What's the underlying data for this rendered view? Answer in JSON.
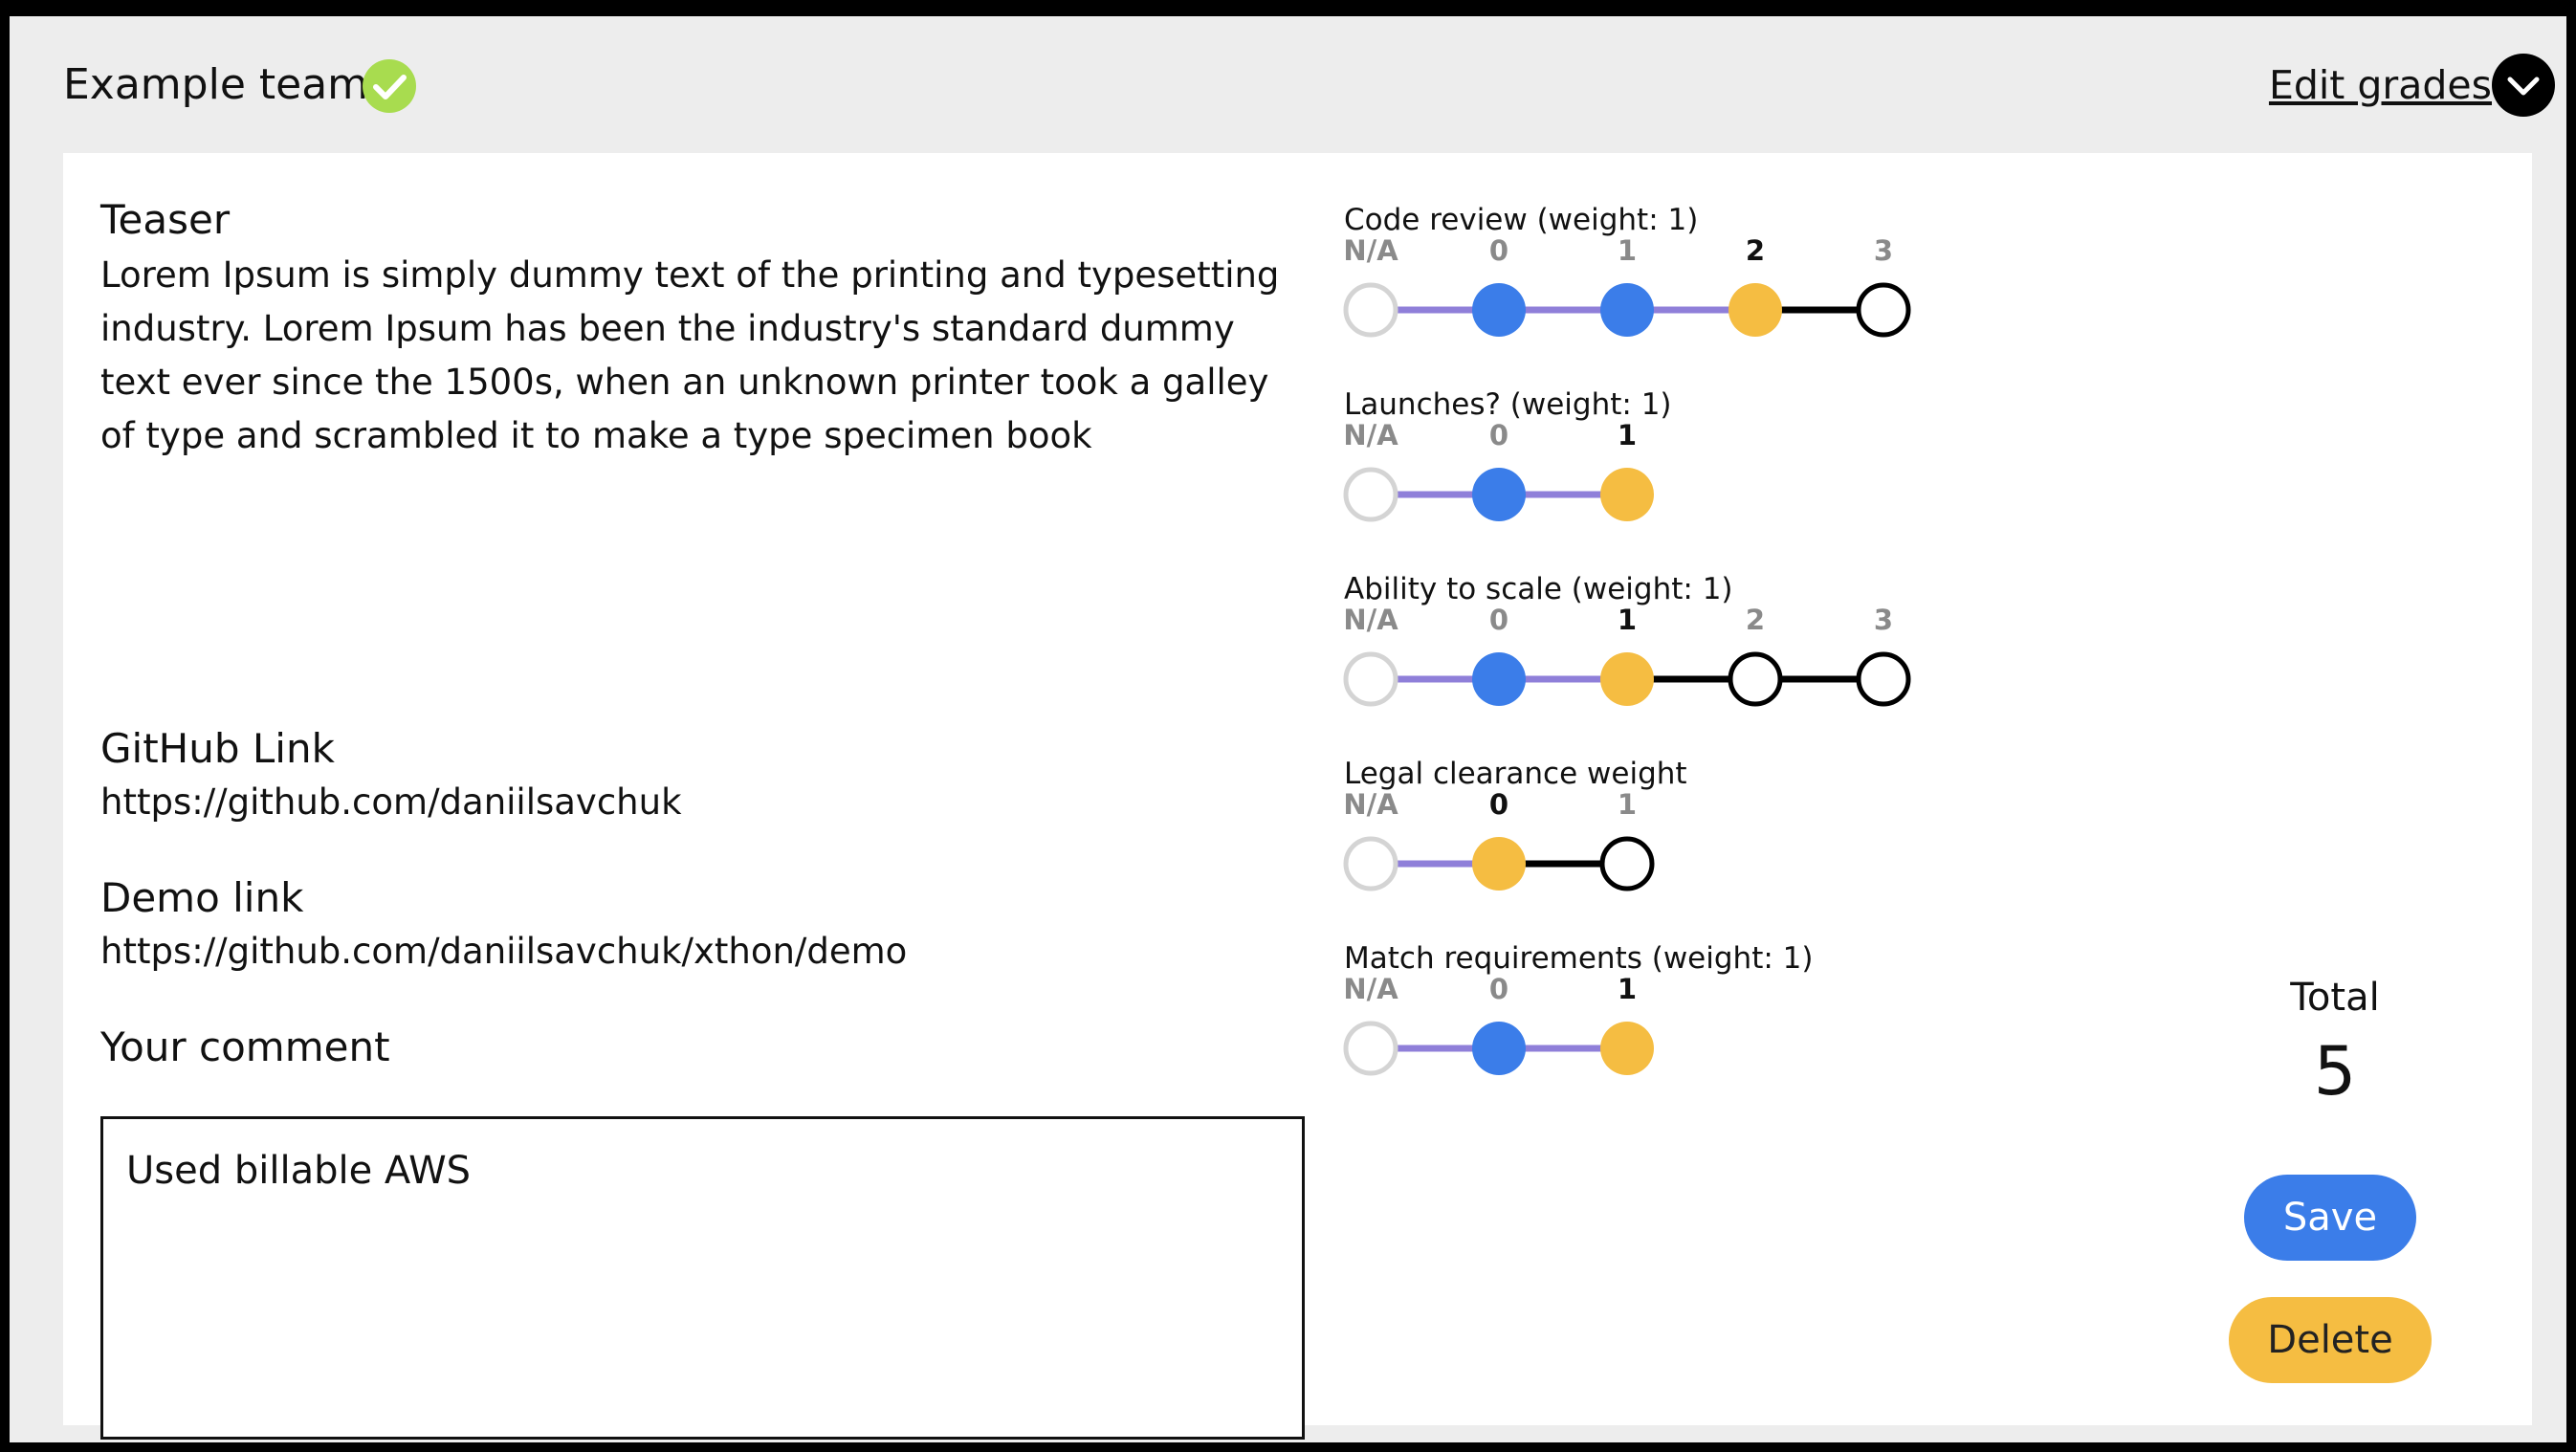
{
  "header": {
    "team_name": "Example team",
    "edit_grades_label": "Edit grades"
  },
  "colors": {
    "accent_blue": "#3b7de9",
    "accent_yellow": "#f5bd42",
    "connector_purple": "#8f7fd9",
    "check_green": "#a8dc4f"
  },
  "icons": {
    "team_status": "check-circle-icon",
    "edit_toggle": "chevron-down-icon"
  },
  "project": {
    "teaser_title": "Teaser",
    "teaser_text": "Lorem Ipsum is simply dummy text of the printing and typesetting industry. Lorem Ipsum has been the industry's standard dummy text ever since the 1500s, when an unknown printer took a galley of type and scrambled it to make a type specimen book",
    "github_title": "GitHub Link",
    "github_url": "https://github.com/daniilsavchuk",
    "demo_title": "Demo link",
    "demo_url": "https://github.com/daniilsavchuk/xthon/demo",
    "comment_title": "Your comment",
    "comment_value": "Used billable AWS"
  },
  "criteria": [
    {
      "title": "Code review (weight: 1)",
      "options": [
        "N/A",
        "0",
        "1",
        "2",
        "3"
      ],
      "selected": "2"
    },
    {
      "title": "Launches? (weight: 1)",
      "options": [
        "N/A",
        "0",
        "1"
      ],
      "selected": "1"
    },
    {
      "title": "Ability to scale (weight: 1)",
      "options": [
        "N/A",
        "0",
        "1",
        "2",
        "3"
      ],
      "selected": "1"
    },
    {
      "title": "Legal clearance weight",
      "options": [
        "N/A",
        "0",
        "1"
      ],
      "selected": "0"
    },
    {
      "title": "Match requirements (weight: 1)",
      "options": [
        "N/A",
        "0",
        "1"
      ],
      "selected": "1"
    }
  ],
  "total": {
    "label": "Total",
    "value": "5"
  },
  "actions": {
    "save_label": "Save",
    "delete_label": "Delete"
  }
}
